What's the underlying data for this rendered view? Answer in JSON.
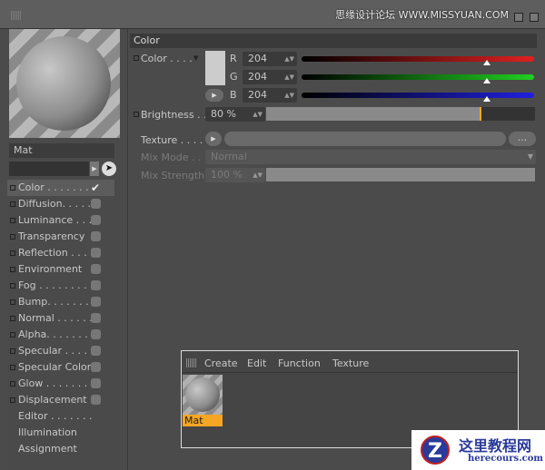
{
  "watermark_top": "思缘设计论坛 WWW.MISSYUAN.COM",
  "material": {
    "name": "Mat"
  },
  "channels": [
    {
      "label": "Color . . . . . . .",
      "checked": true
    },
    {
      "label": "Diffusion. . . . .",
      "checked": false
    },
    {
      "label": "Luminance . . .",
      "checked": false
    },
    {
      "label": "Transparency",
      "checked": false
    },
    {
      "label": "Reflection . . . .",
      "checked": false
    },
    {
      "label": "Environment",
      "checked": false
    },
    {
      "label": "Fog . . . . . . . . .",
      "checked": false
    },
    {
      "label": "Bump. . . . . . . .",
      "checked": false
    },
    {
      "label": "Normal . . . . . .",
      "checked": false
    },
    {
      "label": "Alpha. . . . . . . .",
      "checked": false
    },
    {
      "label": "Specular . . . . .",
      "checked": false
    },
    {
      "label": "Specular Color",
      "checked": false
    },
    {
      "label": "Glow . . . . . . . .",
      "checked": false
    },
    {
      "label": "Displacement",
      "checked": false
    }
  ],
  "extra_items": [
    "Editor . . . . . . .",
    "Illumination",
    "Assignment"
  ],
  "color_section": {
    "title": "Color",
    "color_label": "Color . . . .",
    "swatch": "#cccccc",
    "r_label": "R",
    "r": "204",
    "g_label": "G",
    "g": "204",
    "b_label": "B",
    "b": "204",
    "rgb_fraction": 0.8,
    "brightness_label": "Brightness . .",
    "brightness": "80 %",
    "brightness_fraction": 0.8,
    "texture_label": "Texture . . . .",
    "texture_more": "...",
    "mix_mode_label": "Mix Mode . .",
    "mix_mode": "Normal",
    "mix_strength_label": "Mix Strength",
    "mix_strength": "100 %"
  },
  "manager": {
    "menu": [
      "Create",
      "Edit",
      "Function",
      "Texture"
    ],
    "items": [
      {
        "name": "Mat"
      }
    ]
  },
  "watermark_bottom": {
    "title": "这里教程网",
    "url": "herecours.com"
  },
  "colors": {
    "accent": "#f5a623",
    "red": "#e02020",
    "green": "#20d020",
    "blue": "#2020e0"
  }
}
